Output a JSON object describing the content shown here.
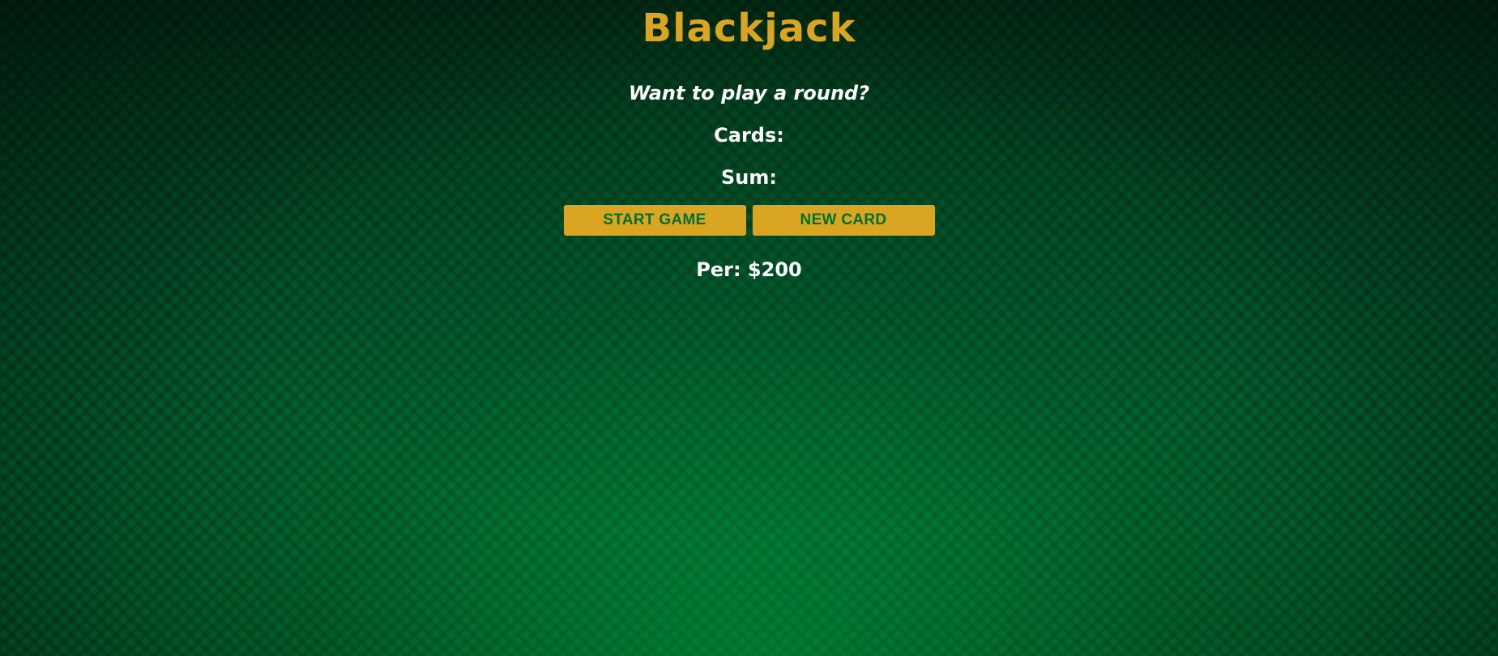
{
  "title": "Blackjack",
  "message": "Want to play a round?",
  "cards_label": "Cards:",
  "sum_label": "Sum:",
  "buttons": {
    "start_game": "START GAME",
    "new_card": "NEW CARD"
  },
  "player": "Per: $200",
  "colors": {
    "accent": "#daa520",
    "button_text": "#016f32",
    "text": "#ffffff",
    "background": "#03612b"
  }
}
